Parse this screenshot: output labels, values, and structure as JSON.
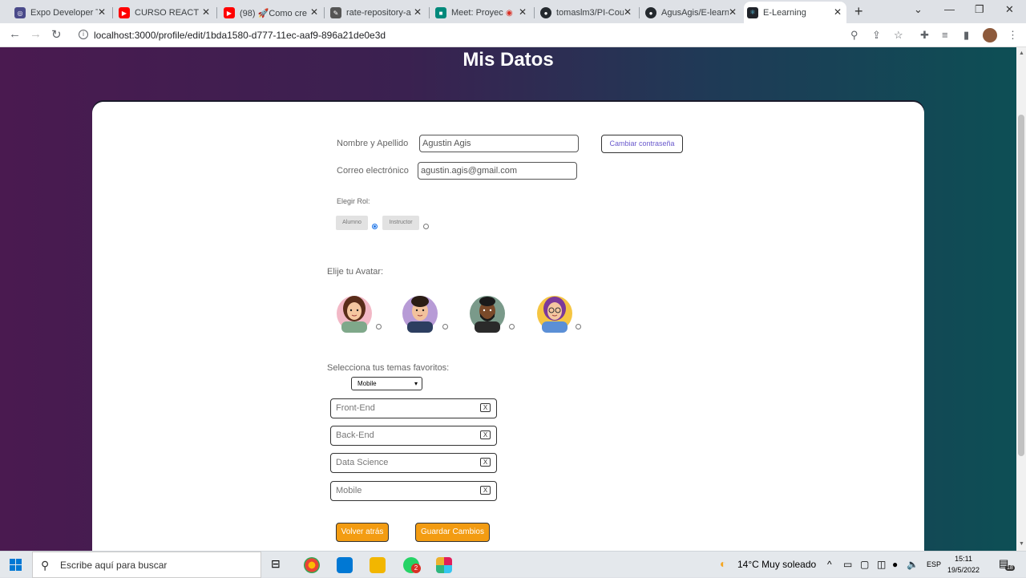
{
  "browser": {
    "tabs": [
      {
        "title": "Expo Developer T",
        "icon": "expo-icon",
        "color": "#4a4a8a"
      },
      {
        "title": "CURSO REACT",
        "icon": "youtube-icon",
        "color": "#ff0000"
      },
      {
        "title": "(98) 🚀Como cre",
        "icon": "youtube-icon",
        "color": "#ff0000"
      },
      {
        "title": "rate-repository-a",
        "icon": "rate-icon",
        "color": "#555555"
      },
      {
        "title": "Meet: Proyec",
        "icon": "meet-icon",
        "color": "#00897b"
      },
      {
        "title": "tomaslm3/PI-Cou",
        "icon": "github-icon",
        "color": "#24292e"
      },
      {
        "title": "AgusAgis/E-learn",
        "icon": "github-icon",
        "color": "#24292e"
      },
      {
        "title": "E-Learning",
        "icon": "react-icon",
        "color": "#20232a"
      }
    ],
    "url": "localhost:3000/profile/edit/1bda1580-d777-11ec-aaf9-896a21de0e3d"
  },
  "page": {
    "title": "Mis Datos",
    "name_label": "Nombre y Apellido",
    "name_value": "Agustin Agis",
    "change_password": "Cambiar contraseña",
    "email_label": "Correo electrónico",
    "email_value": "agustin.agis@gmail.com",
    "role_label": "Elegir Rol:",
    "roles": [
      {
        "label": "Alumno",
        "selected": true
      },
      {
        "label": "Instructor",
        "selected": false
      }
    ],
    "avatar_label": "Elije tu Avatar:",
    "avatars": [
      {
        "name": "avatar-girl-brown-hair",
        "bg": "#f2b8c6",
        "hair": "#5a2d1a",
        "skin": "#f5c7a0",
        "shirt": "#7fa88a"
      },
      {
        "name": "avatar-boy-curly-hair",
        "bg": "#b79bd6",
        "hair": "#2b1d14",
        "skin": "#f2c29c",
        "shirt": "#2c3e60"
      },
      {
        "name": "avatar-boy-dark-skin",
        "bg": "#7a9a8a",
        "hair": "#1a1a1a",
        "skin": "#7a4a2a",
        "shirt": "#2a2a2a"
      },
      {
        "name": "avatar-girl-glasses",
        "bg": "#f5c542",
        "hair": "#7b3a9a",
        "skin": "#f5c7a0",
        "shirt": "#5b8fd6"
      }
    ],
    "topics_label": "Selecciona tus temas favoritos:",
    "topic_select": "Mobile",
    "topics": [
      "Front-End",
      "Back-End",
      "Data Science",
      "Mobile"
    ],
    "remove_label": "X",
    "back_button": "Volver atrás",
    "save_button": "Guardar Cambios"
  },
  "taskbar": {
    "search_placeholder": "Escribe aquí para buscar",
    "weather": "14°C  Muy soleado",
    "language": "ESP",
    "time": "15:11",
    "date": "19/5/2022",
    "notifications": "18",
    "whatsapp_badge": "2"
  }
}
